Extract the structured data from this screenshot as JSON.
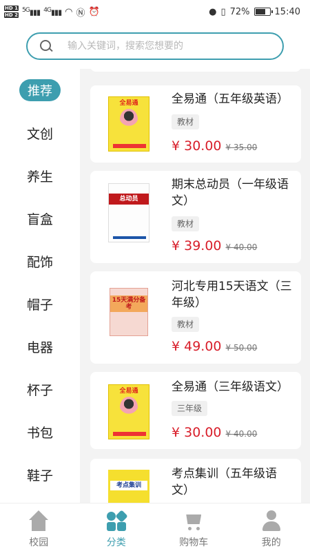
{
  "status_bar": {
    "hd1": "HD 1",
    "hd2": "HD 2",
    "signal1": "5G",
    "signal2": "4G",
    "battery": "72%",
    "time": "15:40"
  },
  "search": {
    "placeholder": "输入关键词，搜索您想要的"
  },
  "sidebar": {
    "items": [
      {
        "label": "推荐"
      },
      {
        "label": "文创"
      },
      {
        "label": "养生"
      },
      {
        "label": "盲盒"
      },
      {
        "label": "配饰"
      },
      {
        "label": "帽子"
      },
      {
        "label": "电器"
      },
      {
        "label": "杯子"
      },
      {
        "label": "书包"
      },
      {
        "label": "鞋子"
      }
    ],
    "active_index": 0
  },
  "products": [
    {
      "title": "全易通（五年级英语）",
      "tag": "教材",
      "price": "¥ 30.00",
      "old_price": "¥ 35.00",
      "cover_text": "全易通"
    },
    {
      "title": "期末总动员（一年级语文）",
      "tag": "教材",
      "price": "¥ 39.00",
      "old_price": "¥ 40.00",
      "cover_text": "总动员"
    },
    {
      "title": "河北专用15天语文（三年级）",
      "tag": "教材",
      "price": "¥ 49.00",
      "old_price": "¥ 50.00",
      "cover_text": "15天满分备考"
    },
    {
      "title": "全易通（三年级语文）",
      "tag": "三年级",
      "price": "¥ 30.00",
      "old_price": "¥ 40.00",
      "cover_text": "全易通"
    },
    {
      "title": "考点集训（五年级语文）",
      "cover_text": "考点集训"
    }
  ],
  "tabbar": {
    "items": [
      {
        "label": "校园",
        "icon": "home-icon"
      },
      {
        "label": "分类",
        "icon": "category-icon"
      },
      {
        "label": "购物车",
        "icon": "cart-icon"
      },
      {
        "label": "我的",
        "icon": "user-icon"
      }
    ],
    "active_index": 1
  },
  "colors": {
    "accent": "#3d9eaf",
    "price": "#d81e2a"
  }
}
